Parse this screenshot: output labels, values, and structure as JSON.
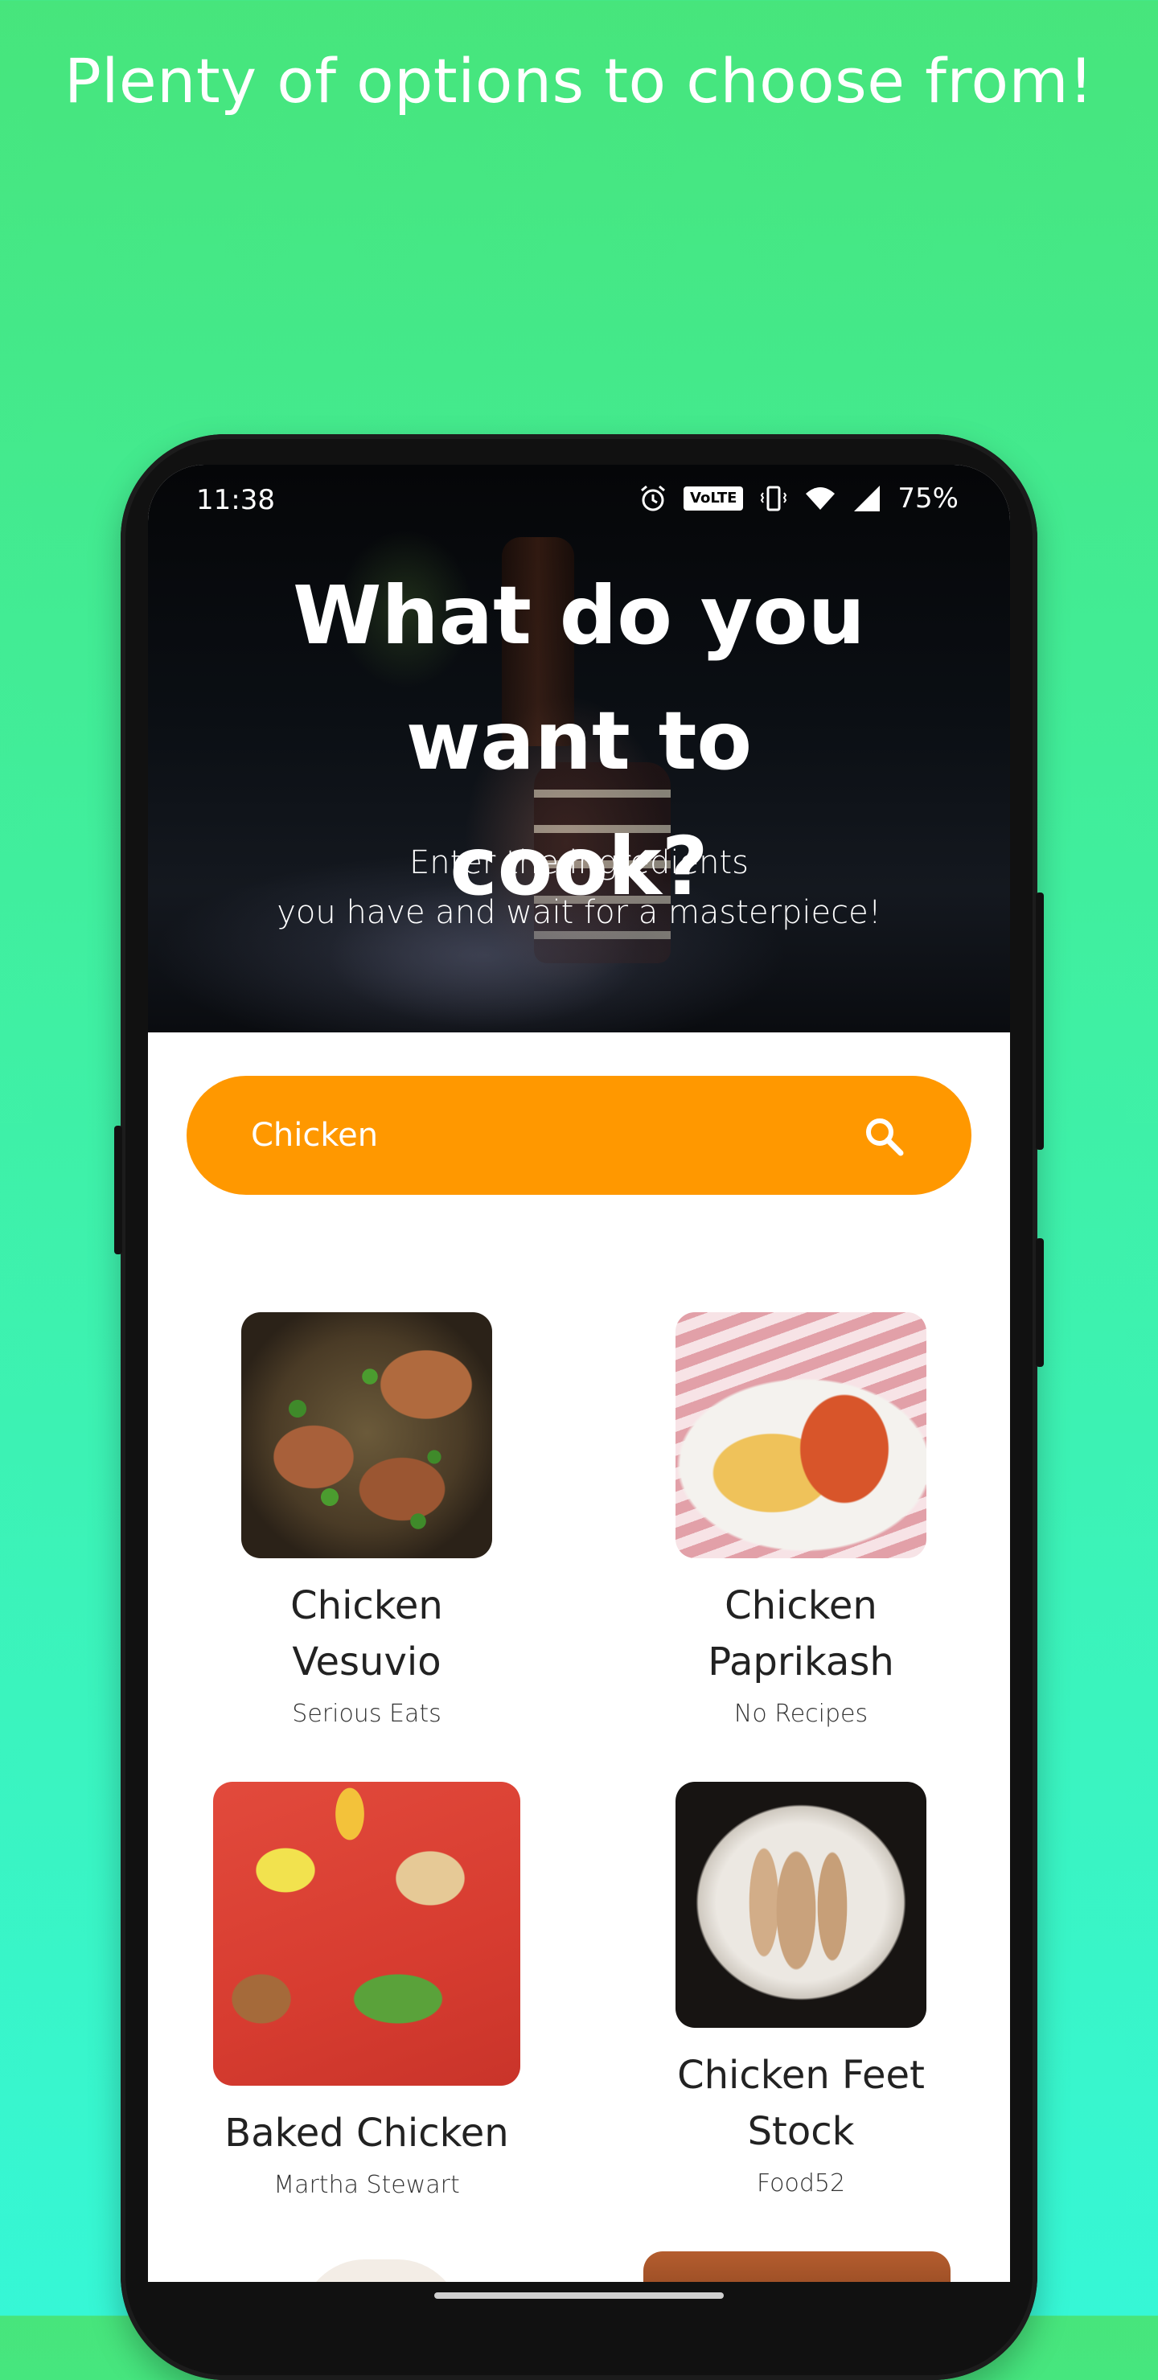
{
  "promo": {
    "title": "Plenty of options to choose from!"
  },
  "status_bar": {
    "time": "11:38",
    "volte": "VoLTE",
    "battery": "75%"
  },
  "hero": {
    "title": "What do you want to cook?",
    "subtitle_line1": "Enter the ingredients",
    "subtitle_line2": "you have and wait for a masterpiece!"
  },
  "search": {
    "value": "Chicken",
    "placeholder": "",
    "icon": "search-icon"
  },
  "colors": {
    "accent": "#ff9800",
    "background_top": "#47e57c",
    "background_bottom": "#36f7d6"
  },
  "recipes": [
    {
      "name": "Chicken Vesuvio",
      "source": "Serious Eats",
      "image": "chicken-vesuvio-photo"
    },
    {
      "name": "Chicken Paprikash",
      "source": "No Recipes",
      "image": "chicken-paprikash-photo"
    },
    {
      "name": "Baked Chicken",
      "source": "Martha Stewart",
      "image": "baked-chicken-photo"
    },
    {
      "name": "Chicken Feet Stock",
      "source": "Food52",
      "image": "chicken-feet-stock-photo"
    }
  ]
}
